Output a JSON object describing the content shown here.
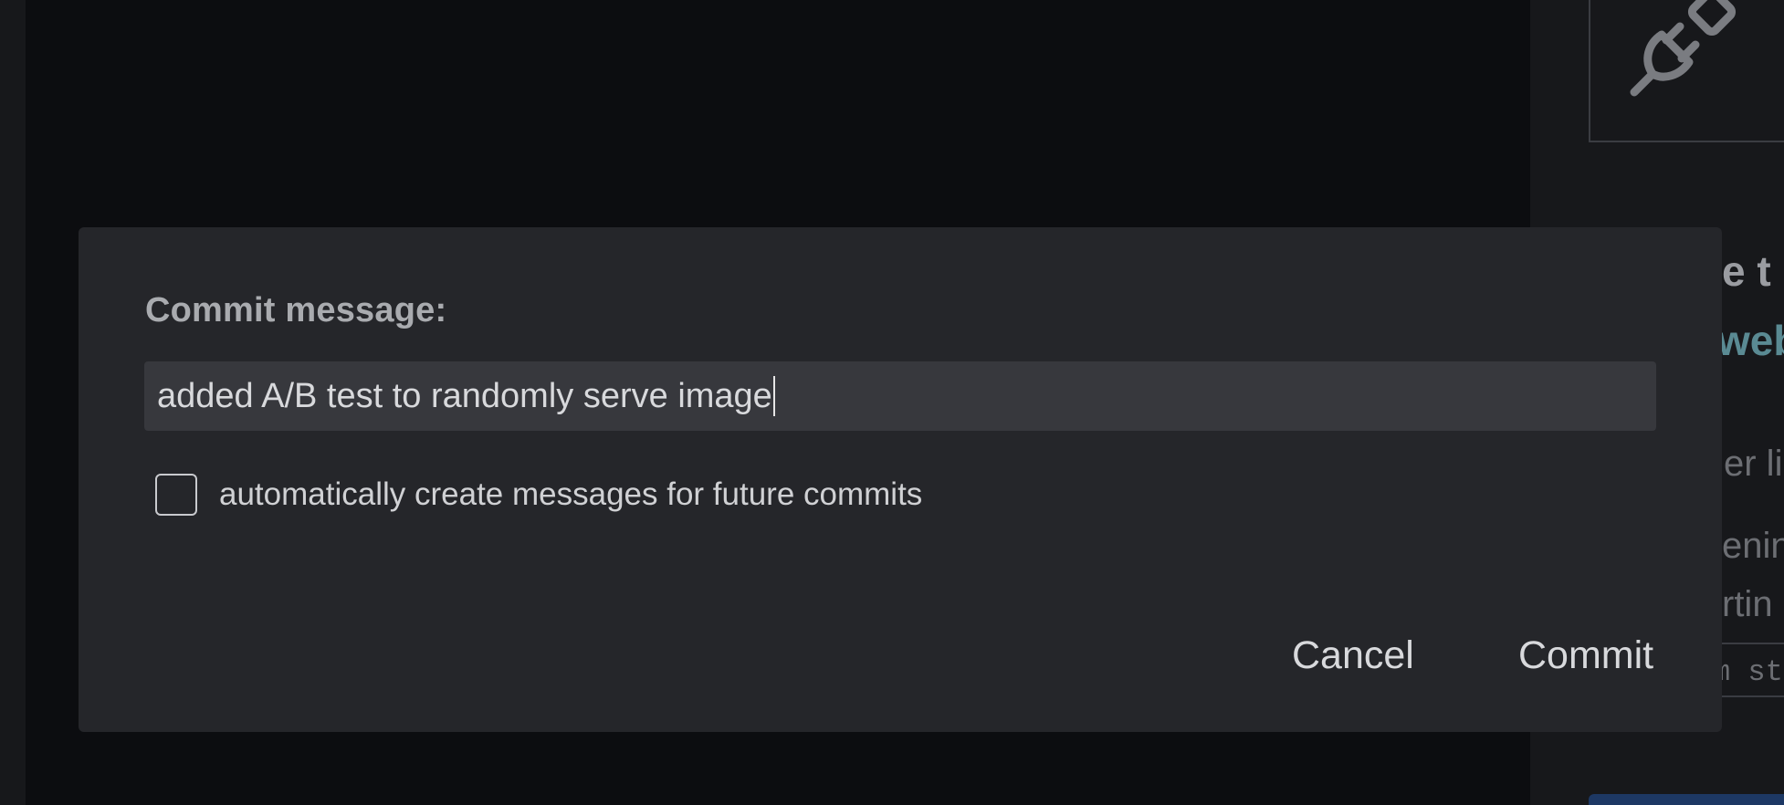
{
  "dialog": {
    "label": "Commit message:",
    "message_value": "added A/B test to randomly serve image",
    "auto_option_label": "automatically create messages for future commits",
    "auto_option_checked": false,
    "cancel_label": "Cancel",
    "commit_label": "Commit"
  },
  "right_panel": {
    "heading_fragment": "e t",
    "link_fragment": "web",
    "text_line_1": "er li",
    "text_line_2": "enin",
    "text_line_3": "rtin",
    "code_fragment": "m st",
    "illustration_icon": "plug-icon"
  },
  "colors": {
    "dialog_bg": "#25262a",
    "input_bg": "#37383d",
    "backdrop": "#0c0d10",
    "link": "#5a8a93"
  }
}
